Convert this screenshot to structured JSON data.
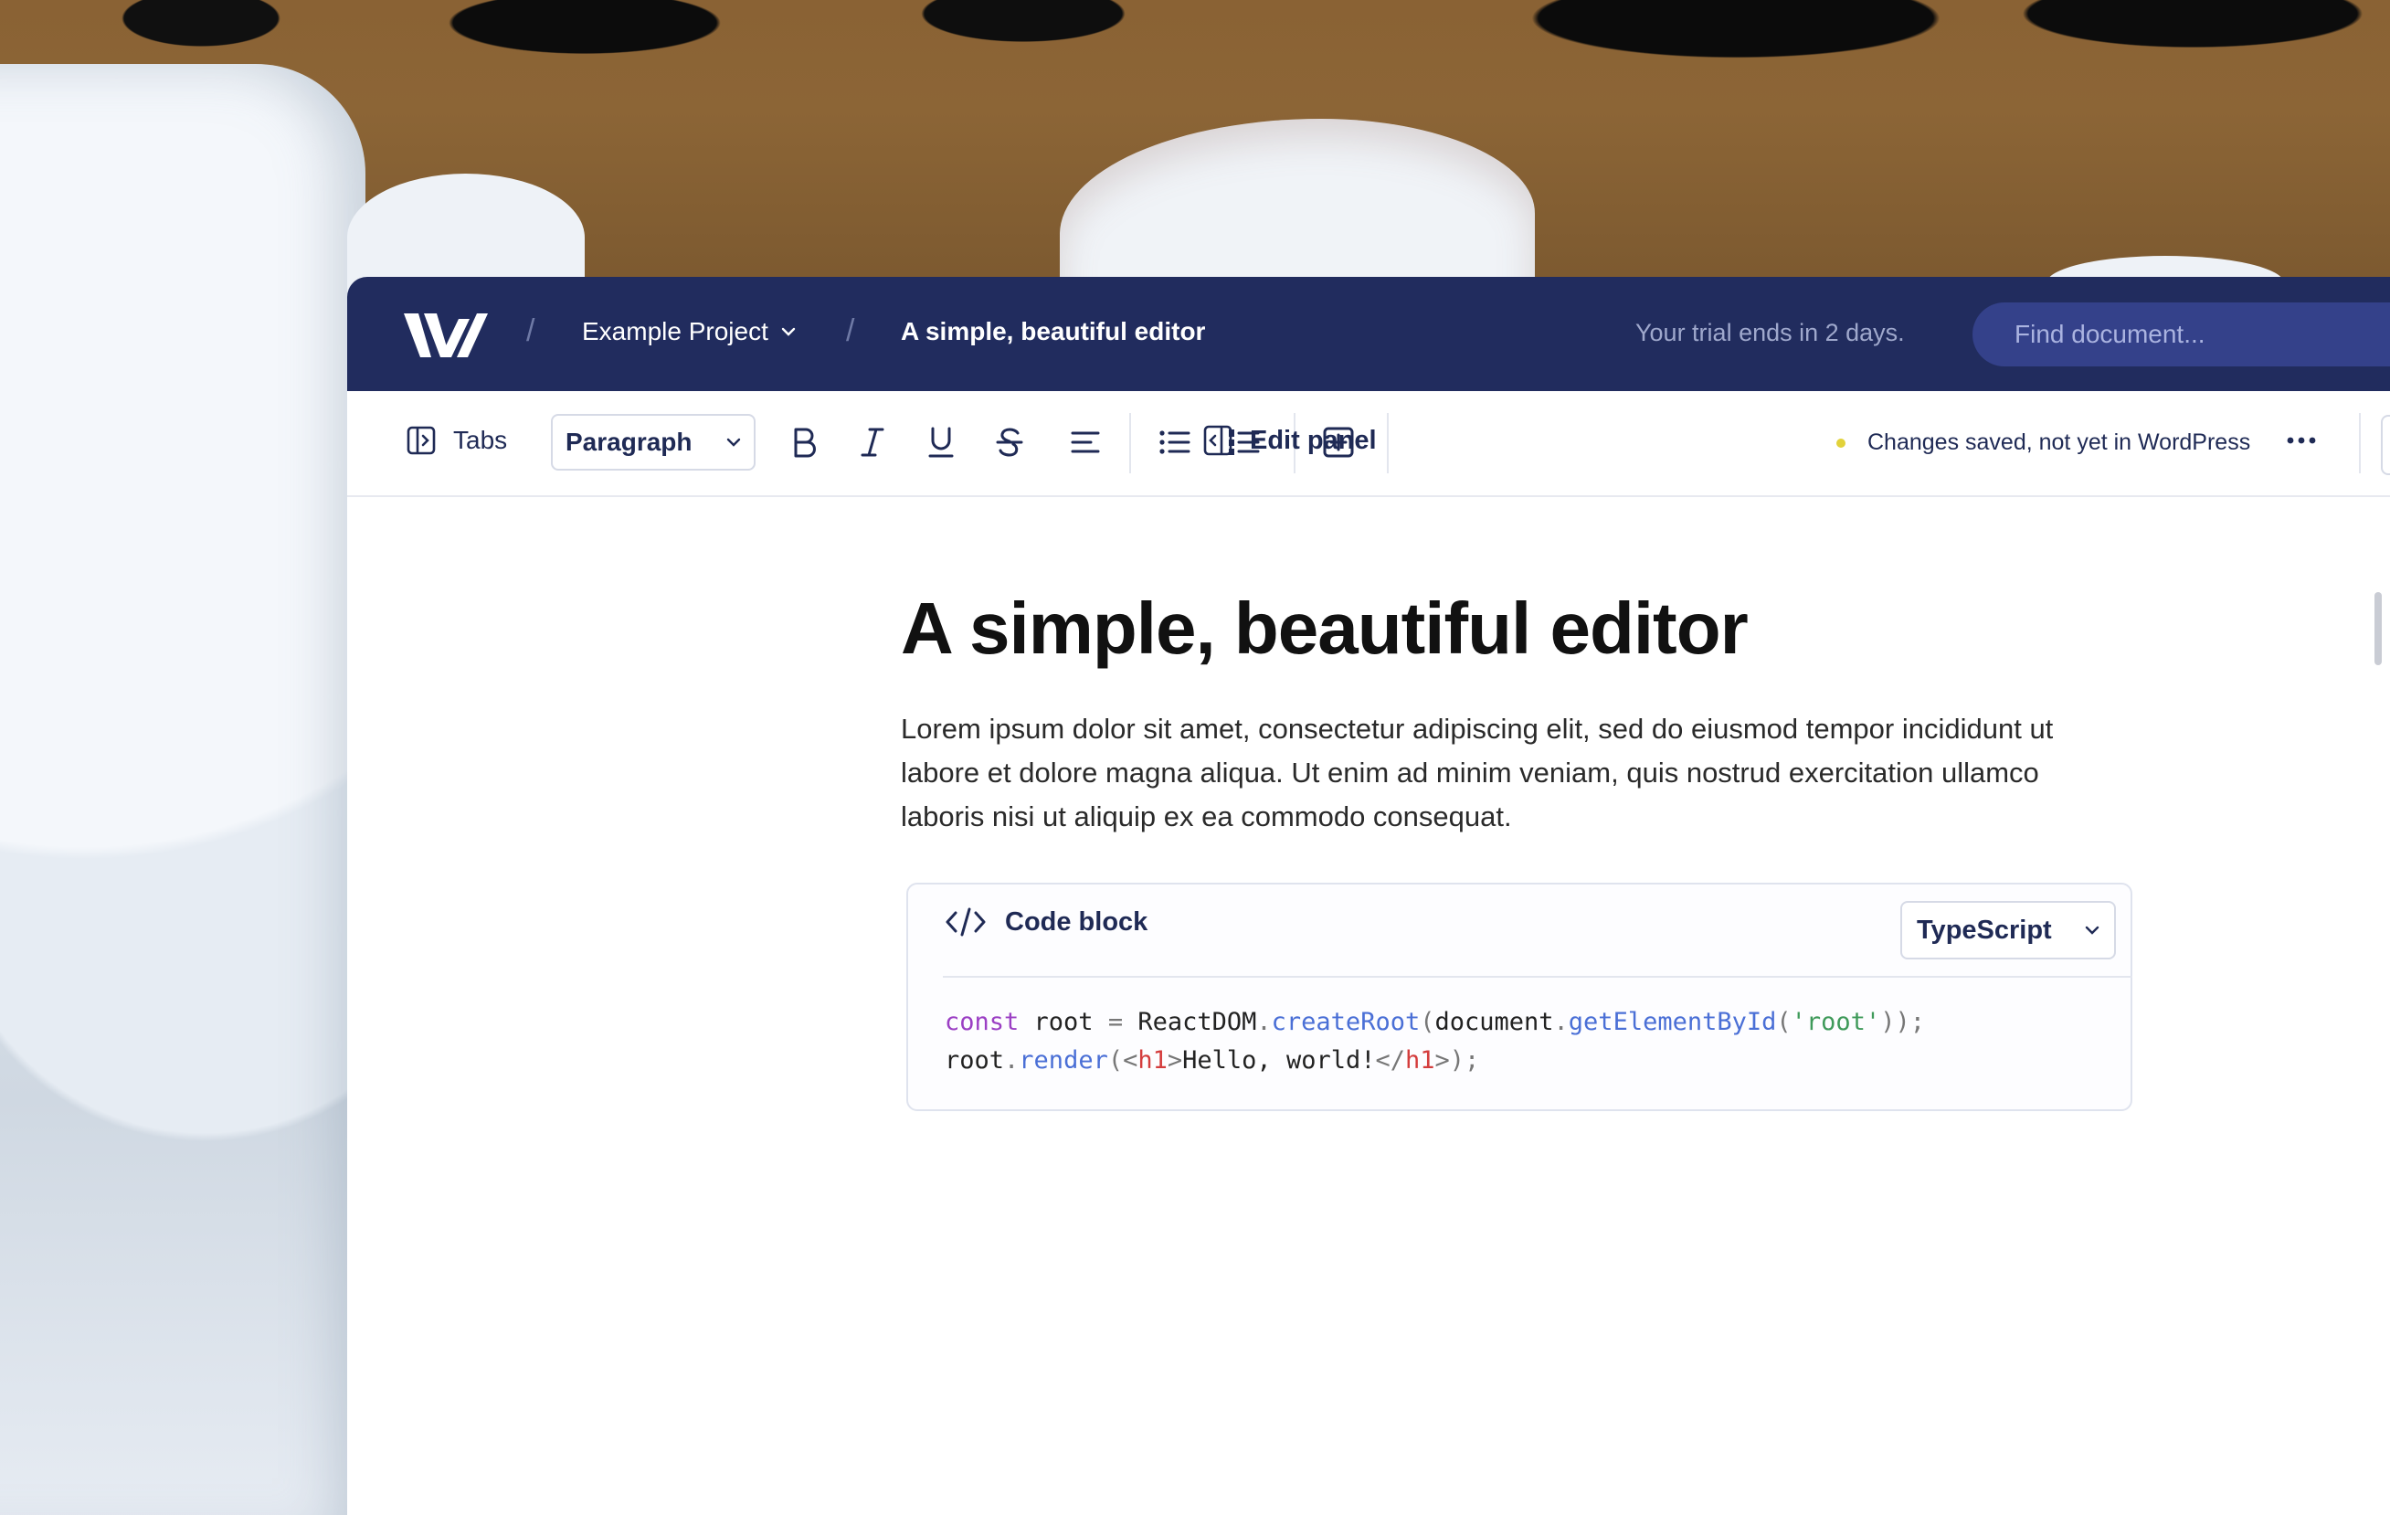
{
  "header": {
    "project": "Example Project",
    "document_title": "A simple, beautiful editor",
    "trial_notice": "Your trial ends in 2 days.",
    "search_placeholder": "Find document..."
  },
  "toolbar": {
    "tabs_label": "Tabs",
    "block_type": "Paragraph",
    "edit_panel_label": "Edit panel",
    "status_text": "Changes saved, not yet in WordPress",
    "status_color": "#e2d23a"
  },
  "document": {
    "title": "A simple, beautiful editor",
    "paragraph": "Lorem ipsum dolor sit amet, consectetur adipiscing elit, sed do eiusmod tempor incididunt ut labore et dolore magna aliqua. Ut enim ad minim veniam, quis nostrud exercitation ullamco laboris nisi ut aliquip ex ea commodo consequat.",
    "code_block": {
      "title": "Code block",
      "language": "TypeScript",
      "lines": [
        "const root = ReactDOM.createRoot(document.getElementById('root'));",
        "root.render(<h1>Hello, world!</h1>);"
      ]
    }
  },
  "colors": {
    "topbar": "#212c5e",
    "accent_text": "#1f2a55"
  }
}
